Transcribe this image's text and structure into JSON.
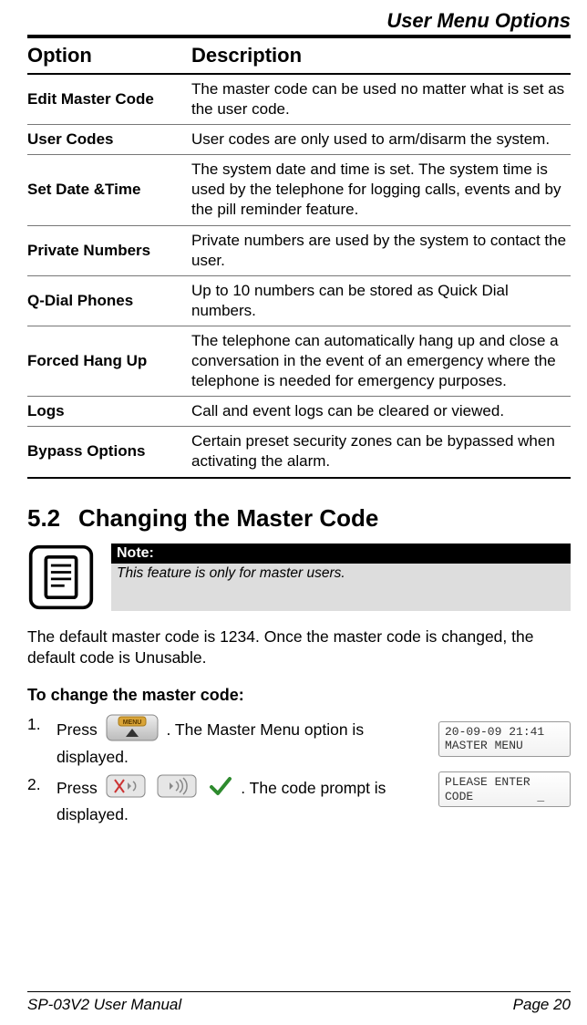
{
  "page_title": "User Menu Options",
  "table": {
    "header_option": "Option",
    "header_description": "Description",
    "rows": [
      {
        "option": "Edit Master Code",
        "desc": "The master code can be used no matter what is set as the user code."
      },
      {
        "option": "User Codes",
        "desc": "User codes are only used to arm/disarm the system."
      },
      {
        "option": "Set Date &Time",
        "desc": "The system date and time is set. The system time is used by the telephone for logging calls, events and by the pill reminder feature."
      },
      {
        "option": "Private Numbers",
        "desc": "Private numbers are used by the system to contact the user."
      },
      {
        "option": "Q-Dial Phones",
        "desc": "Up to 10 numbers can be stored as Quick Dial numbers."
      },
      {
        "option": "Forced Hang Up",
        "desc": "The telephone can automatically hang up and close a conversation in the event of an emergency where the telephone is needed for emergency purposes."
      },
      {
        "option": "Logs",
        "desc": "Call and event logs can be cleared or viewed."
      },
      {
        "option": "Bypass Options",
        "desc": "Certain preset security zones can be bypassed when activating the alarm."
      }
    ]
  },
  "section": {
    "num": "5.2",
    "title": "Changing the Master Code",
    "note_label": "Note:",
    "note_text": "This feature is only for master users.",
    "intro": "The default master code is 1234. Once the master code is changed, the default code is Unusable.",
    "subhead": "To change the master code:",
    "step1_a": "Press ",
    "step1_b": ". The Master Menu option is displayed.",
    "step2_a": "Press ",
    "step2_b": ". The code prompt is displayed.",
    "lcd1": "20-09-09 21:41\nMASTER MENU",
    "lcd2": "PLEASE ENTER\nCODE         _"
  },
  "footer": {
    "left": "SP-03V2 User Manual",
    "right": "Page 20"
  }
}
